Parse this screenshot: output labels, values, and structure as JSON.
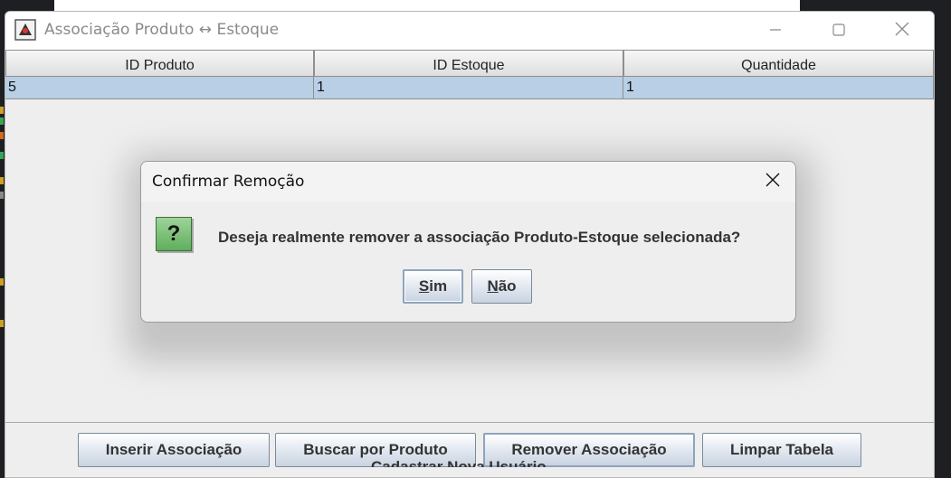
{
  "window": {
    "title": "Associação Produto ↔ Estoque",
    "minimize_icon": "minimize-icon",
    "maximize_icon": "maximize-icon",
    "close_icon": "close-icon"
  },
  "table": {
    "columns": [
      "ID Produto",
      "ID Estoque",
      "Quantidade"
    ],
    "rows": [
      {
        "id_produto": "5",
        "id_estoque": "1",
        "quantidade": "1",
        "selected": true
      }
    ],
    "selection_color": "#b8cfe5"
  },
  "buttons": {
    "inserir": "Inserir Associação",
    "buscar": "Buscar por Produto",
    "remover": "Remover Associação",
    "limpar": "Limpar Tabela"
  },
  "below_text": "Cadastrar Nova Usuário",
  "dialog": {
    "title": "Confirmar Remoção",
    "icon": "question-icon",
    "icon_glyph": "?",
    "message": "Deseja realmente remover a associação Produto-Estoque selecionada?",
    "yes_mnemonic": "S",
    "yes_rest": "im",
    "no_mnemonic": "N",
    "no_rest": "ão"
  }
}
